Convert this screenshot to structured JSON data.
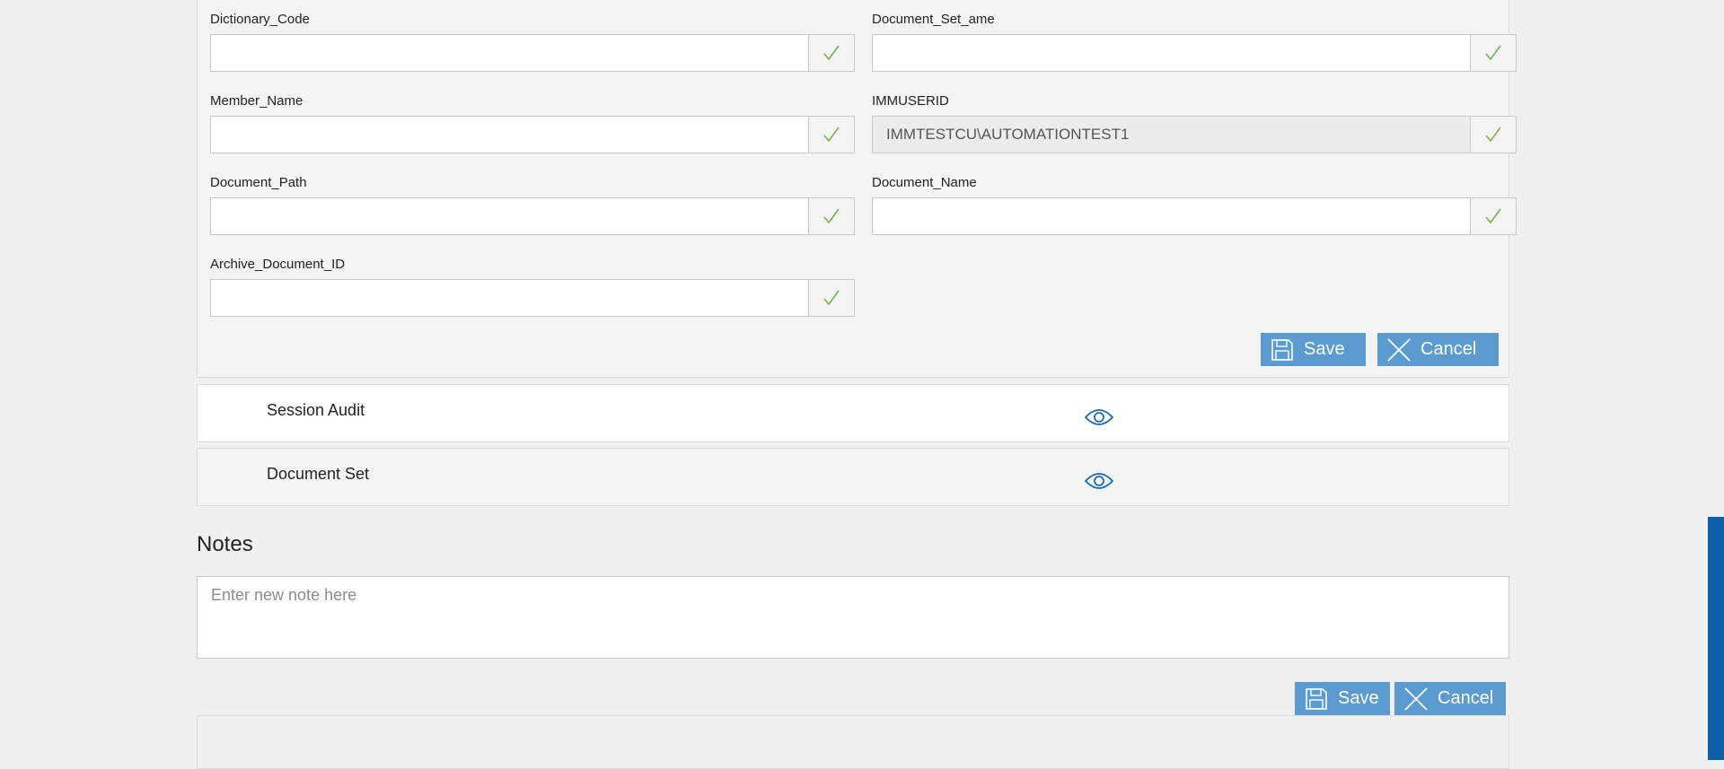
{
  "form": {
    "fields": [
      {
        "label": "Dictionary_Code",
        "value": "",
        "placeholder": ""
      },
      {
        "label": "Document_Set_ame",
        "value": "",
        "placeholder": ""
      },
      {
        "label": "Member_Name",
        "value": "",
        "placeholder": ""
      },
      {
        "label": "IMMUSERID",
        "value": "IMMTESTCU\\AUTOMATIONTEST1",
        "placeholder": "",
        "disabled": true
      },
      {
        "label": "Document_Path",
        "value": "",
        "placeholder": ""
      },
      {
        "label": "Document_Name",
        "value": "",
        "placeholder": ""
      },
      {
        "label": "Archive_Document_ID",
        "value": "",
        "placeholder": ""
      }
    ],
    "save_label": "Save",
    "cancel_label": "Cancel",
    "check_icon": "checkmark-icon"
  },
  "sections": [
    {
      "title": "Session Audit",
      "icon": "eye-icon",
      "background": "#ffffff"
    },
    {
      "title": "Document Set",
      "icon": "eye-icon",
      "background": "#f4f4f4"
    }
  ],
  "notes": {
    "heading": "Notes",
    "placeholder": "Enter new note here",
    "value": "",
    "save_label": "Save",
    "cancel_label": "Cancel"
  },
  "colors": {
    "button": "#5b9bd0",
    "check": "#7ab04a",
    "eye": "#1f6fb0",
    "scrollbar": "#0a5fa8"
  }
}
